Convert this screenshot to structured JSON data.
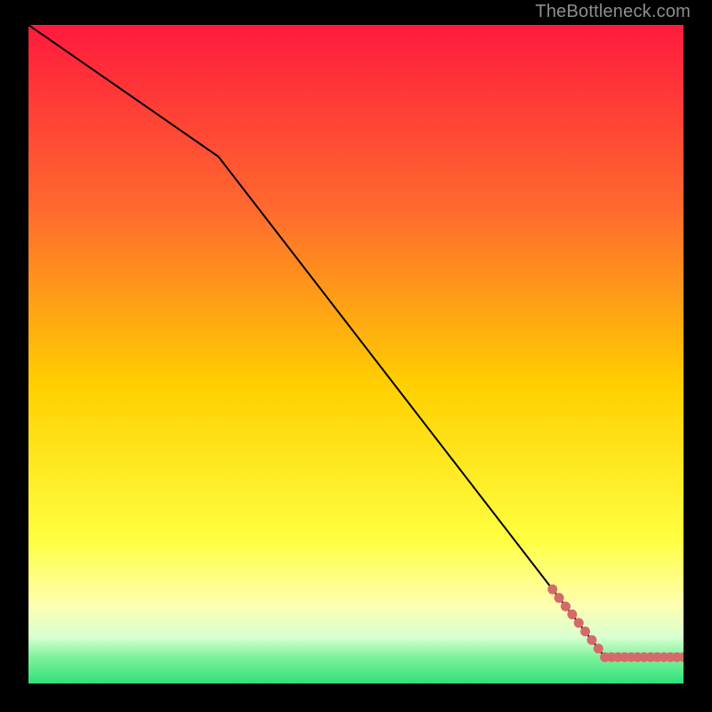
{
  "attribution": "TheBottleneck.com",
  "colors": {
    "background_black": "#000000",
    "line": "#000000",
    "marker": "#d46a6a",
    "gradient_top": "#ff1a3d",
    "gradient_mid_upper": "#ff7a2a",
    "gradient_mid": "#ffd400",
    "gradient_mid_lower": "#ffff66",
    "gradient_pale_band": "#ffffcc",
    "gradient_low_green": "#7ef29a",
    "gradient_bottom_green": "#2fe07a"
  },
  "chart_data": {
    "type": "line",
    "title": "",
    "xlabel": "",
    "ylabel": "",
    "xlim": [
      0,
      100
    ],
    "ylim": [
      0,
      100
    ],
    "series": [
      {
        "name": "curve",
        "x": [
          0,
          29,
          88,
          100
        ],
        "y": [
          100,
          80,
          4,
          4
        ]
      }
    ],
    "markers": {
      "name": "points",
      "x": [
        80,
        81,
        82,
        83,
        84,
        85,
        86,
        87,
        88,
        89,
        90,
        91,
        92,
        93,
        94,
        95,
        96,
        97,
        98,
        99,
        100
      ],
      "y": [
        14.3,
        13.0,
        11.7,
        10.5,
        9.2,
        7.9,
        6.6,
        5.3,
        4.0,
        4.0,
        4.0,
        4.0,
        4.0,
        4.0,
        4.0,
        4.0,
        4.0,
        4.0,
        4.0,
        4.0,
        4.0
      ]
    },
    "gradient_stops": [
      {
        "offset": 0.0,
        "color": "#ff1a3d"
      },
      {
        "offset": 0.28,
        "color": "#ff6a2e"
      },
      {
        "offset": 0.55,
        "color": "#ffd000"
      },
      {
        "offset": 0.78,
        "color": "#ffff40"
      },
      {
        "offset": 0.88,
        "color": "#ffffb0"
      },
      {
        "offset": 0.93,
        "color": "#d8ffd0"
      },
      {
        "offset": 0.96,
        "color": "#7ef29a"
      },
      {
        "offset": 1.0,
        "color": "#2fe07a"
      }
    ]
  }
}
